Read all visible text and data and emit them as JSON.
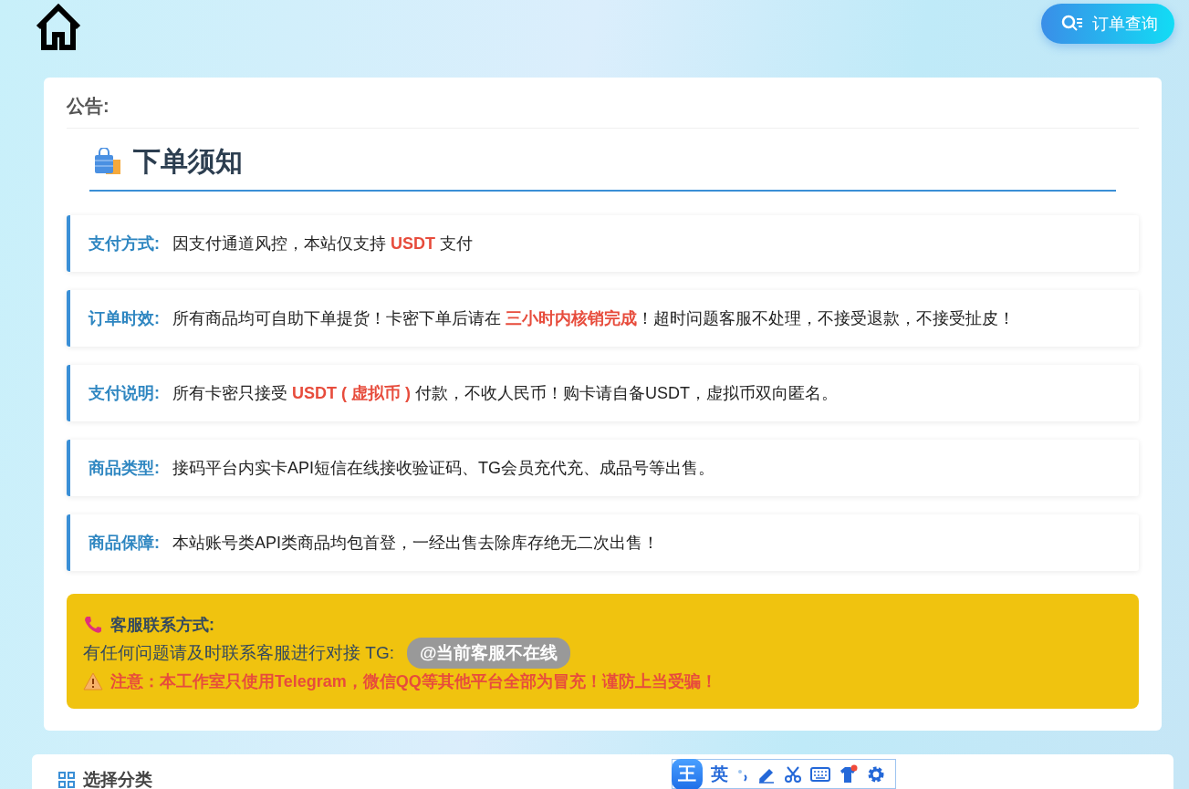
{
  "header": {
    "order_button": "订单查询"
  },
  "notice": {
    "heading": "公告:",
    "title": "下单须知",
    "items": [
      {
        "label": "支付方式:",
        "text": "因支付通道风控，本站仅支持 **USDT** 支付"
      },
      {
        "label": "订单时效:",
        "text": "所有商品均可自助下单提货！卡密下单后请在 **三小时内核销完成**！超时问题客服不处理，不接受退款，不接受扯皮！"
      },
      {
        "label": "支付说明:",
        "text": "所有卡密只接受 **USDT ( 虚拟币 )** 付款，不收人民币！购卡请自备USDT，虚拟币双向匿名。"
      },
      {
        "label": "商品类型:",
        "text": "接码平台内实卡API短信在线接收验证码、TG会员充代充、成品号等出售。"
      },
      {
        "label": "商品保障:",
        "text": "本站账号类API类商品均包首登，一经出售去除库存绝无二次出售！"
      }
    ],
    "contact": {
      "title": "客服联系方式:",
      "line": "有任何问题请及时联系客服进行对接 TG:",
      "tg_badge": "@当前客服不在线",
      "warning": "注意：本工作室只使用Telegram，微信QQ等其他平台全部为冒充！谨防上当受骗！"
    }
  },
  "category": {
    "title": "选择分类"
  },
  "ime_toolbar": {
    "logo": "王",
    "mode": "英"
  }
}
